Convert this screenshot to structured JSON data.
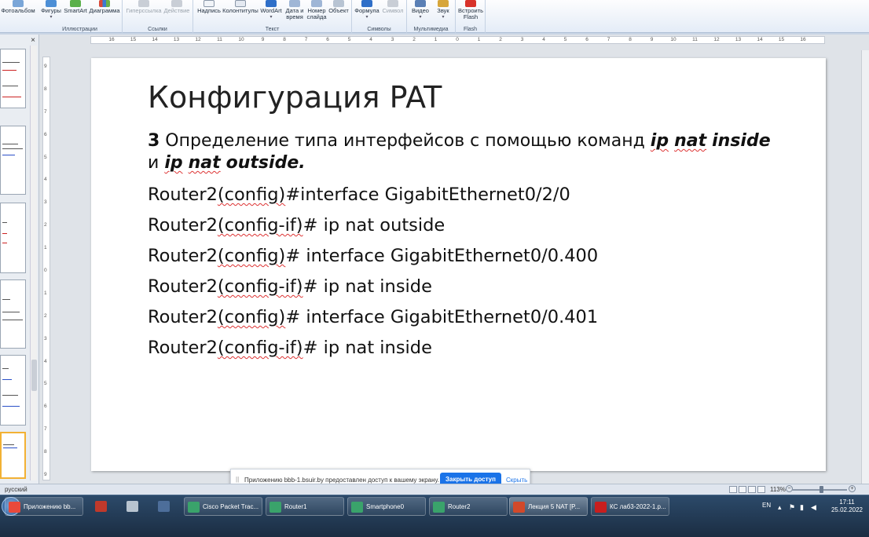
{
  "ribbon": {
    "fotoalbum": "Фотоальбом",
    "groups": {
      "illustrations": {
        "label": "Иллюстрации",
        "items": [
          "Фигуры",
          "SmartArt",
          "Диаграмма"
        ]
      },
      "links": {
        "label": "Ссылки",
        "items": [
          "Гиперссылка",
          "Действие"
        ]
      },
      "text": {
        "label": "Текст",
        "items": [
          "Надпись",
          "Колонтитулы",
          "WordArt",
          "Дата и время",
          "Номер слайда",
          "Объект"
        ]
      },
      "symbols": {
        "label": "Символы",
        "items": [
          "Формула",
          "Символ"
        ]
      },
      "multimedia": {
        "label": "Мультимедиа",
        "items": [
          "Видео",
          "Звук"
        ]
      },
      "flash": {
        "label": "Flash",
        "items": [
          "Встроить Flash"
        ]
      }
    }
  },
  "ruler": {
    "h_ticks": [
      "16",
      "15",
      "14",
      "13",
      "12",
      "11",
      "10",
      "9",
      "8",
      "7",
      "6",
      "5",
      "4",
      "3",
      "2",
      "1",
      "0",
      "1",
      "2",
      "3",
      "4",
      "5",
      "6",
      "7",
      "8",
      "9",
      "10",
      "11",
      "12",
      "13",
      "14",
      "15",
      "16"
    ],
    "v_ticks": [
      "9",
      "8",
      "7",
      "6",
      "5",
      "4",
      "3",
      "2",
      "1",
      "0",
      "1",
      "2",
      "3",
      "4",
      "5",
      "6",
      "7",
      "8",
      "9"
    ]
  },
  "slide": {
    "title": "Конфигурация PAT",
    "step_number": "3",
    "step_text": " Определение типа интерфейсов с помощью команд ",
    "kw_inside_ip": "ip",
    "kw_inside_nat": "nat",
    "kw_inside_word": "inside",
    "conj": "и",
    "kw_outside_ip": "ip",
    "kw_outside_nat": "nat",
    "kw_outside_word": "outside.",
    "commands": [
      {
        "router": "Router2",
        "mode": "(config)",
        "rest": "#interface GigabitEthernet0/2/0"
      },
      {
        "router": "Router2",
        "mode": "(config-if)",
        "rest": "# ip nat outside"
      },
      {
        "router": "Router2",
        "mode": "(config)",
        "rest": "# interface GigabitEthernet0/0.400"
      },
      {
        "router": "Router2",
        "mode": "(config-if)",
        "rest": "# ip nat inside"
      },
      {
        "router": "Router2",
        "mode": "(config)",
        "rest": "# interface GigabitEthernet0/0.401"
      },
      {
        "router": "Router2",
        "mode": "(config-if)",
        "rest": "# ip nat inside"
      }
    ]
  },
  "sharebar": {
    "grip": "||",
    "message": "Приложению bbb-1.bsuir.by предоставлен доступ к вашему экрану.",
    "stop": "Закрыть доступ",
    "hide": "Скрыть"
  },
  "status": {
    "language": "русский",
    "zoom": "113%",
    "zoom_minus": "−",
    "zoom_plus": "+"
  },
  "taskbar": {
    "items": [
      {
        "label": "Приложению bb...",
        "icon_color": "#e9493b"
      },
      {
        "label": "",
        "icon_color": "#c0392b"
      },
      {
        "label": "",
        "icon_color": "#b8c4d0"
      },
      {
        "label": "",
        "icon_color": "#4d6e9a"
      },
      {
        "label": "Cisco Packet Trac...",
        "icon_color": "#3aa36b"
      },
      {
        "label": "Router1",
        "icon_color": "#3aa36b"
      },
      {
        "label": "Smartphone0",
        "icon_color": "#3aa36b"
      },
      {
        "label": "Router2",
        "icon_color": "#3aa36b"
      },
      {
        "label": "Лекция 5 NAT [P...",
        "icon_color": "#d2492a"
      },
      {
        "label": "КС лаб3-2022-1.р...",
        "icon_color": "#c81e1e"
      }
    ],
    "tray": {
      "lang": "EN",
      "time": "17:11",
      "date": "25.02.2022",
      "arrow": "▴"
    }
  }
}
